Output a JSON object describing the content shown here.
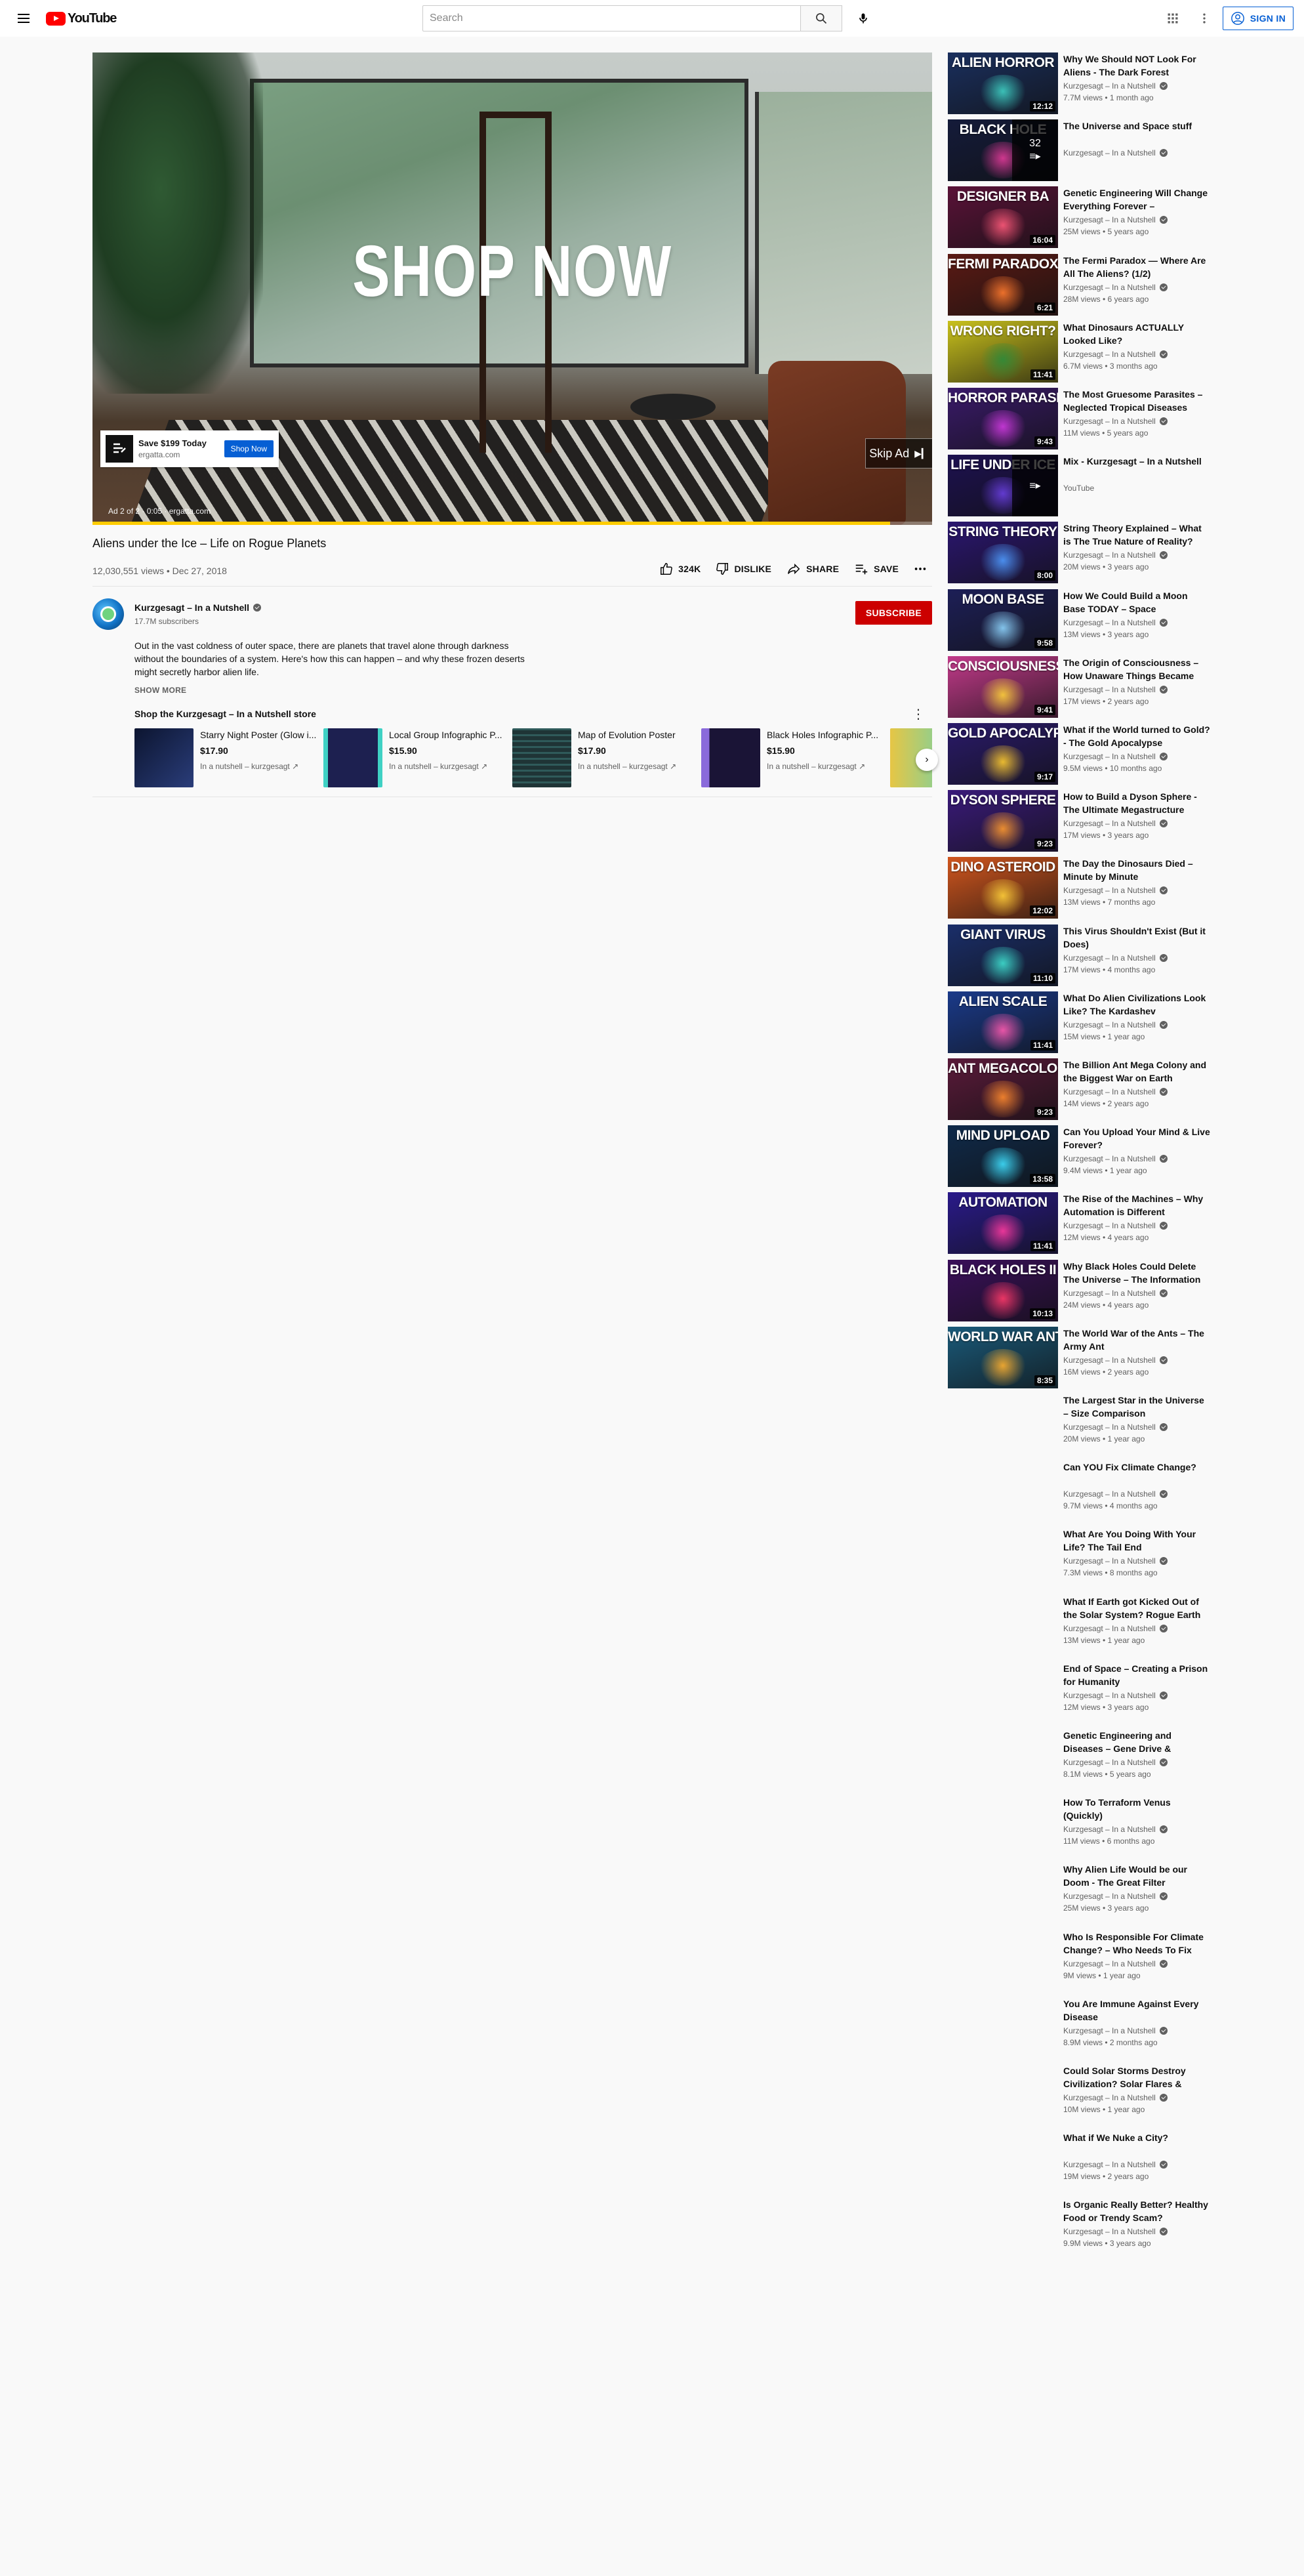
{
  "masthead": {
    "logo_text": "YouTube",
    "search_placeholder": "Search",
    "signin_label": "SIGN IN"
  },
  "ad": {
    "headline": "SHOP NOW",
    "card_title": "Save $199 Today",
    "card_url": "ergatta.com",
    "card_button": "Shop Now",
    "info": "Ad 2 of 2 · 0:05 · ergatta.com",
    "skip_label": "Skip Ad",
    "progress_fraction": 0.95,
    "progress_color": "#ffcc00"
  },
  "video": {
    "title": "Aliens under the Ice – Life on Rogue Planets",
    "views_date": "12,030,551 views • Dec 27, 2018",
    "likes": "324K",
    "dislike_label": "DISLIKE",
    "share_label": "SHARE",
    "save_label": "SAVE"
  },
  "channel": {
    "name": "Kurzgesagt – In a Nutshell",
    "subscribers": "17.7M subscribers",
    "subscribe_label": "SUBSCRIBE",
    "description": "Out in the vast coldness of outer space, there are planets that travel alone through darkness without the boundaries of a system. Here's how this can happen – and why these frozen deserts might secretly harbor alien life.",
    "show_more": "SHOW MORE"
  },
  "shop": {
    "title": "Shop the Kurzgesagt – In a Nutshell store",
    "products": [
      {
        "name": "Starry Night Poster (Glow i...",
        "price": "$17.90",
        "vendor": "In a nutshell – kurzgesagt",
        "color": "#1d2a4d"
      },
      {
        "name": "Local Group Infographic P...",
        "price": "$15.90",
        "vendor": "In a nutshell – kurzgesagt",
        "color": "#262a57"
      },
      {
        "name": "Map of Evolution Poster",
        "price": "$17.90",
        "vendor": "In a nutshell – kurzgesagt",
        "color": "#20383a"
      },
      {
        "name": "Black Holes Infographic P...",
        "price": "$15.90",
        "vendor": "In a nutshell – kurzgesagt",
        "color": "#2a2045"
      },
      {
        "name": "",
        "price": "",
        "vendor": "",
        "color": "#e6c645"
      }
    ]
  },
  "recommendations": [
    {
      "thumb_text": "ALIEN HORROR",
      "thumb_color": "#1a2f5e",
      "accent": "#3fd1c4",
      "duration": "12:12",
      "title": "Why We Should NOT Look For Aliens - The Dark Forest",
      "channel": "Kurzgesagt – In a Nutshell",
      "meta": "7.7M views • 1 month ago"
    },
    {
      "thumb_text": "BLACK HOLE",
      "thumb_color": "#141b3a",
      "accent": "#e43b9a",
      "duration": "",
      "mix_count": "32",
      "title": "The Universe and Space stuff",
      "channel": "Kurzgesagt – In a Nutshell",
      "meta": ""
    },
    {
      "thumb_text": "DESIGNER BA",
      "thumb_color": "#5a1238",
      "accent": "#ff5a7a",
      "duration": "16:04",
      "title": "Genetic Engineering Will Change Everything Forever –",
      "channel": "Kurzgesagt – In a Nutshell",
      "meta": "25M views • 5 years ago"
    },
    {
      "thumb_text": "FERMI PARADOX",
      "thumb_color": "#5b1a14",
      "accent": "#ff7a2e",
      "duration": "6:21",
      "title": "The Fermi Paradox — Where Are All The Aliens? (1/2)",
      "channel": "Kurzgesagt – In a Nutshell",
      "meta": "28M views • 6 years ago"
    },
    {
      "thumb_text": "WRONG   RIGHT?",
      "thumb_color": "#c9c11c",
      "accent": "#2e8b3a",
      "duration": "11:41",
      "title": "What Dinosaurs ACTUALLY Looked Like?",
      "channel": "Kurzgesagt – In a Nutshell",
      "meta": "6.7M views • 3 months ago"
    },
    {
      "thumb_text": "HORROR PARASITES",
      "thumb_color": "#3a1a6a",
      "accent": "#d03ae0",
      "duration": "9:43",
      "title": "The Most Gruesome Parasites – Neglected Tropical Diseases",
      "channel": "Kurzgesagt – In a Nutshell",
      "meta": "11M views • 5 years ago"
    },
    {
      "thumb_text": "LIFE UNDER ICE",
      "thumb_color": "#1d1150",
      "accent": "#6a3fe0",
      "duration": "",
      "mix_count": "",
      "title": "Mix - Kurzgesagt – In a Nutshell",
      "channel": "YouTube",
      "meta": ""
    },
    {
      "thumb_text": "STRING THEORY",
      "thumb_color": "#2b1670",
      "accent": "#4f9bff",
      "duration": "8:00",
      "title": "String Theory Explained – What is The True Nature of Reality?",
      "channel": "Kurzgesagt – In a Nutshell",
      "meta": "20M views • 3 years ago"
    },
    {
      "thumb_text": "MOON BASE",
      "thumb_color": "#1d1f57",
      "accent": "#8fd6ff",
      "duration": "9:58",
      "title": "How We Could Build a Moon Base TODAY – Space",
      "channel": "Kurzgesagt – In a Nutshell",
      "meta": "13M views • 3 years ago"
    },
    {
      "thumb_text": "CONSCIOUSNESS",
      "thumb_color": "#c23a8a",
      "accent": "#ffd23a",
      "duration": "9:41",
      "title": "The Origin of Consciousness – How Unaware Things Became",
      "channel": "Kurzgesagt – In a Nutshell",
      "meta": "17M views • 2 years ago"
    },
    {
      "thumb_text": "GOLD APOCALYPSE",
      "thumb_color": "#2a1a6a",
      "accent": "#ffcc2e",
      "duration": "9:17",
      "title": "What if the World turned to Gold? - The Gold Apocalypse",
      "channel": "Kurzgesagt – In a Nutshell",
      "meta": "9.5M views • 10 months ago"
    },
    {
      "thumb_text": "DYSON SPHERE",
      "thumb_color": "#3a1a7a",
      "accent": "#ff9a2e",
      "duration": "9:23",
      "title": "How to Build a Dyson Sphere - The Ultimate Megastructure",
      "channel": "Kurzgesagt – In a Nutshell",
      "meta": "17M views • 3 years ago"
    },
    {
      "thumb_text": "DINO ASTEROID",
      "thumb_color": "#d1561e",
      "accent": "#ffd03a",
      "duration": "12:02",
      "title": "The Day the Dinosaurs Died – Minute by Minute",
      "channel": "Kurzgesagt – In a Nutshell",
      "meta": "13M views • 7 months ago"
    },
    {
      "thumb_text": "GIANT VIRUS",
      "thumb_color": "#1a2e6a",
      "accent": "#3fe0d0",
      "duration": "11:10",
      "title": "This Virus Shouldn't Exist (But it Does)",
      "channel": "Kurzgesagt – In a Nutshell",
      "meta": "17M views • 4 months ago"
    },
    {
      "thumb_text": "ALIEN SCALE",
      "thumb_color": "#1a3a8a",
      "accent": "#ff5ab0",
      "duration": "11:41",
      "title": "What Do Alien Civilizations Look Like? The Kardashev",
      "channel": "Kurzgesagt – In a Nutshell",
      "meta": "15M views • 1 year ago"
    },
    {
      "thumb_text": "ANT MEGACOLONY",
      "thumb_color": "#5a1a3a",
      "accent": "#ff8a2e",
      "duration": "9:23",
      "title": "The Billion Ant Mega Colony and the Biggest War on Earth",
      "channel": "Kurzgesagt – In a Nutshell",
      "meta": "14M views • 2 years ago"
    },
    {
      "thumb_text": "MIND UPLOAD",
      "thumb_color": "#0f2a4a",
      "accent": "#3fe0ff",
      "duration": "13:58",
      "title": "Can You Upload Your Mind & Live Forever?",
      "channel": "Kurzgesagt – In a Nutshell",
      "meta": "9.4M views • 1 year ago"
    },
    {
      "thumb_text": "AUTOMATION",
      "thumb_color": "#2a1a8a",
      "accent": "#ff3aa0",
      "duration": "11:41",
      "title": "The Rise of the Machines – Why Automation is Different",
      "channel": "Kurzgesagt – In a Nutshell",
      "meta": "12M views • 4 years ago"
    },
    {
      "thumb_text": "BLACK HOLES II",
      "thumb_color": "#3a0f5a",
      "accent": "#ff3a6a",
      "duration": "10:13",
      "title": "Why Black Holes Could Delete The Universe – The Information",
      "channel": "Kurzgesagt – In a Nutshell",
      "meta": "24M views • 4 years ago"
    },
    {
      "thumb_text": "WORLD WAR ANT",
      "thumb_color": "#1a5a7a",
      "accent": "#ffb02e",
      "duration": "8:35",
      "title": "The World War of the Ants – The Army Ant",
      "channel": "Kurzgesagt – In a Nutshell",
      "meta": "16M views • 2 years ago"
    },
    {
      "thumb_text": "",
      "thumb_color": "",
      "accent": "",
      "duration": "",
      "title": "The Largest Star in the Universe – Size Comparison",
      "channel": "Kurzgesagt – In a Nutshell",
      "meta": "20M views • 1 year ago"
    },
    {
      "thumb_text": "",
      "thumb_color": "",
      "accent": "",
      "duration": "",
      "title": "Can YOU Fix Climate Change?",
      "channel": "Kurzgesagt – In a Nutshell",
      "meta": "9.7M views • 4 months ago"
    },
    {
      "thumb_text": "",
      "thumb_color": "",
      "accent": "",
      "duration": "",
      "title": "What Are You Doing With Your Life? The Tail End",
      "channel": "Kurzgesagt – In a Nutshell",
      "meta": "7.3M views • 8 months ago"
    },
    {
      "thumb_text": "",
      "thumb_color": "",
      "accent": "",
      "duration": "",
      "title": "What If Earth got Kicked Out of the Solar System? Rogue Earth",
      "channel": "Kurzgesagt – In a Nutshell",
      "meta": "13M views • 1 year ago"
    },
    {
      "thumb_text": "",
      "thumb_color": "",
      "accent": "",
      "duration": "",
      "title": "End of Space – Creating a Prison for Humanity",
      "channel": "Kurzgesagt – In a Nutshell",
      "meta": "12M views • 3 years ago"
    },
    {
      "thumb_text": "",
      "thumb_color": "",
      "accent": "",
      "duration": "",
      "title": "Genetic Engineering and Diseases – Gene Drive &",
      "channel": "Kurzgesagt – In a Nutshell",
      "meta": "8.1M views • 5 years ago"
    },
    {
      "thumb_text": "",
      "thumb_color": "",
      "accent": "",
      "duration": "",
      "title": "How To Terraform Venus (Quickly)",
      "channel": "Kurzgesagt – In a Nutshell",
      "meta": "11M views • 6 months ago"
    },
    {
      "thumb_text": "",
      "thumb_color": "",
      "accent": "",
      "duration": "",
      "title": "Why Alien Life Would be our Doom - The Great Filter",
      "channel": "Kurzgesagt – In a Nutshell",
      "meta": "25M views • 3 years ago"
    },
    {
      "thumb_text": "",
      "thumb_color": "",
      "accent": "",
      "duration": "",
      "title": "Who Is Responsible For Climate Change? – Who Needs To Fix",
      "channel": "Kurzgesagt – In a Nutshell",
      "meta": "9M views • 1 year ago"
    },
    {
      "thumb_text": "",
      "thumb_color": "",
      "accent": "",
      "duration": "",
      "title": "You Are Immune Against Every Disease",
      "channel": "Kurzgesagt – In a Nutshell",
      "meta": "8.9M views • 2 months ago"
    },
    {
      "thumb_text": "",
      "thumb_color": "",
      "accent": "",
      "duration": "",
      "title": "Could Solar Storms Destroy Civilization? Solar Flares &",
      "channel": "Kurzgesagt – In a Nutshell",
      "meta": "10M views • 1 year ago"
    },
    {
      "thumb_text": "",
      "thumb_color": "",
      "accent": "",
      "duration": "",
      "title": "What if We Nuke a City?",
      "channel": "Kurzgesagt – In a Nutshell",
      "meta": "19M views • 2 years ago"
    },
    {
      "thumb_text": "",
      "thumb_color": "",
      "accent": "",
      "duration": "",
      "title": "Is Organic Really Better? Healthy Food or Trendy Scam?",
      "channel": "Kurzgesagt – In a Nutshell",
      "meta": "9.9M views • 3 years ago"
    }
  ]
}
